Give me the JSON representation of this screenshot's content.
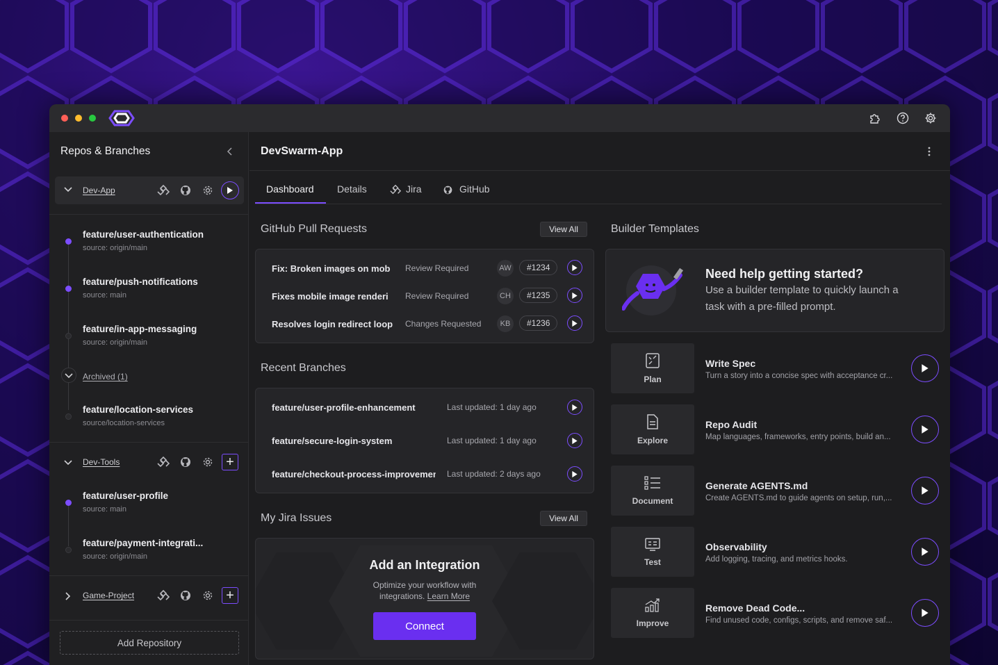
{
  "colors": {
    "accent": "#7c4dff",
    "connect": "#6a2ff0",
    "bg_window": "#1d1d1f"
  },
  "titlebar": {
    "icons": [
      "puzzle-icon",
      "help-icon",
      "gear-icon"
    ]
  },
  "sidebar": {
    "title": "Repos & Branches",
    "repos": [
      {
        "name": "Dev-App",
        "expanded": true,
        "branches": [
          {
            "name": "feature/user-authentication",
            "source": "source: origin/main",
            "active": true
          },
          {
            "name": "feature/push-notifications",
            "source": "source: main",
            "active": true
          },
          {
            "name": "feature/in-app-messaging",
            "source": "source: origin/main",
            "active": false
          }
        ],
        "archived_label": "Archived (1)",
        "archived": [
          {
            "name": "feature/location-services",
            "source": "source/location-services",
            "active": false
          }
        ]
      },
      {
        "name": "Dev-Tools",
        "expanded": true,
        "branches": [
          {
            "name": "feature/user-profile",
            "source": "source: main",
            "active": true
          },
          {
            "name": "feature/payment-integrati...",
            "source": "source: origin/main",
            "active": false
          }
        ]
      },
      {
        "name": "Game-Project",
        "expanded": false,
        "branches": []
      }
    ],
    "add_repo_label": "Add Repository"
  },
  "main": {
    "title": "DevSwarm-App",
    "tabs": [
      {
        "label": "Dashboard",
        "active": true
      },
      {
        "label": "Details"
      },
      {
        "label": "Jira"
      },
      {
        "label": "GitHub"
      }
    ],
    "pull_requests": {
      "title": "GitHub Pull Requests",
      "view_all": "View All",
      "items": [
        {
          "title": "Fix: Broken images on mob",
          "status": "Review Required",
          "author": "AW",
          "number": "#1234"
        },
        {
          "title": "Fixes mobile image renderi",
          "status": "Review Required",
          "author": "CH",
          "number": "#1235"
        },
        {
          "title": "Resolves login redirect loop",
          "status": "Changes Requested",
          "author": "KB",
          "number": "#1236"
        }
      ]
    },
    "recent_branches": {
      "title": "Recent Branches",
      "items": [
        {
          "name": "feature/user-profile-enhancement",
          "updated": "Last updated: 1 day ago"
        },
        {
          "name": "feature/secure-login-system",
          "updated": "Last updated: 1 day ago"
        },
        {
          "name": "feature/checkout-process-improvement",
          "updated": "Last updated: 2 days ago"
        }
      ]
    },
    "jira": {
      "title": "My Jira Issues",
      "view_all": "View All",
      "integration_title": "Add an Integration",
      "integration_desc_1": "Optimize your workflow with",
      "integration_desc_2": "integrations.",
      "learn_more": "Learn More",
      "connect": "Connect"
    },
    "builder": {
      "title": "Builder Templates",
      "help_title": "Need help getting started?",
      "help_desc_1": "Use a builder template to quickly launch a",
      "help_desc_2": "task with a pre-filled prompt.",
      "templates": [
        {
          "category": "Plan",
          "icon": "plan-icon",
          "title": "Write Spec",
          "desc": "Turn a story into a concise spec with acceptance cr..."
        },
        {
          "category": "Explore",
          "icon": "document-icon",
          "title": "Repo Audit",
          "desc": "Map languages, frameworks, entry points, build an..."
        },
        {
          "category": "Document",
          "icon": "list-icon",
          "title": "Generate AGENTS.md",
          "desc": "Create AGENTS.md to guide agents on setup, run,..."
        },
        {
          "category": "Test",
          "icon": "test-icon",
          "title": "Observability",
          "desc": "Add logging, tracing, and metrics hooks."
        },
        {
          "category": "Improve",
          "icon": "chart-up-icon",
          "title": "Remove Dead Code...",
          "desc": "Find unused code, configs, scripts, and remove saf..."
        }
      ]
    }
  }
}
